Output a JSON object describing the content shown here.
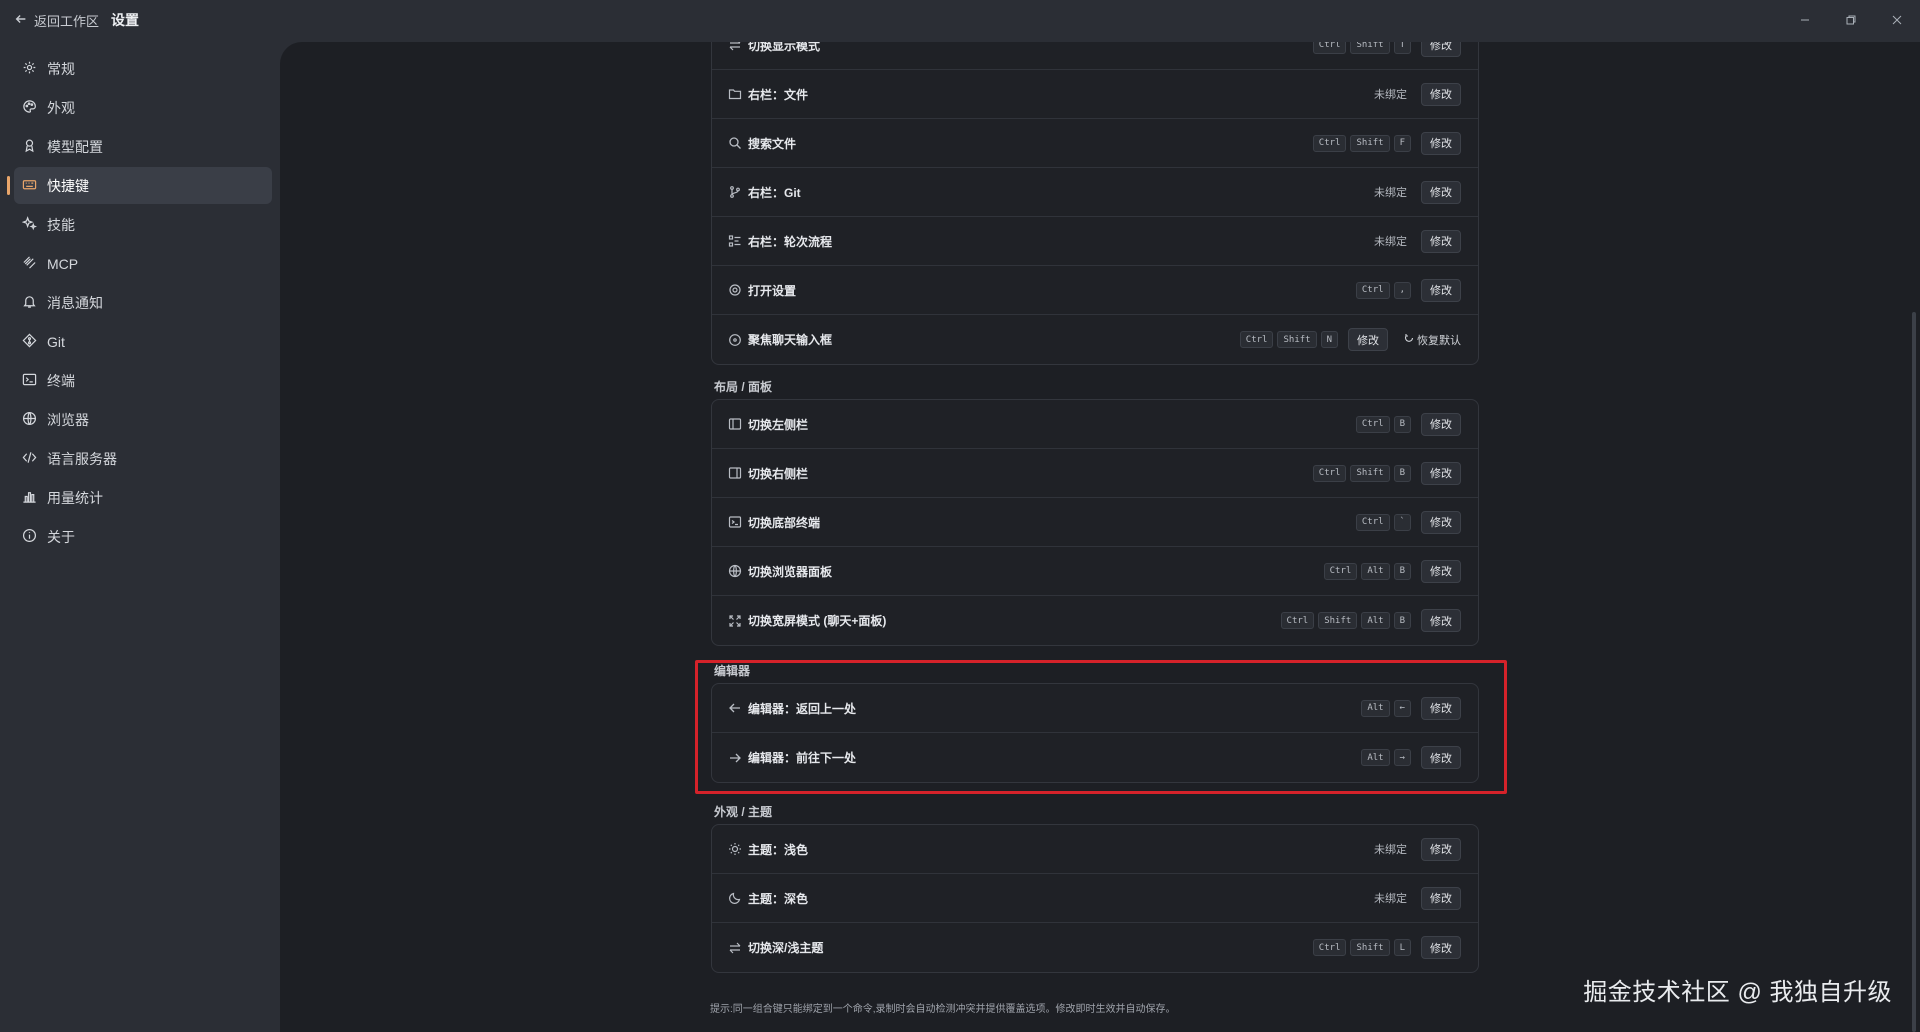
{
  "titlebar": {
    "back_label": "返回工作区",
    "title": "设置"
  },
  "sidebar": {
    "items": [
      {
        "label": "常规",
        "icon": "gear-icon"
      },
      {
        "label": "外观",
        "icon": "palette-icon"
      },
      {
        "label": "模型配置",
        "icon": "model-icon"
      },
      {
        "label": "快捷键",
        "icon": "keyboard-icon",
        "active": true
      },
      {
        "label": "技能",
        "icon": "sparkle-icon"
      },
      {
        "label": "MCP",
        "icon": "mcp-icon"
      },
      {
        "label": "消息通知",
        "icon": "bell-icon"
      },
      {
        "label": "Git",
        "icon": "git-icon"
      },
      {
        "label": "终端",
        "icon": "terminal-icon"
      },
      {
        "label": "浏览器",
        "icon": "globe-icon"
      },
      {
        "label": "语言服务器",
        "icon": "code-icon"
      },
      {
        "label": "用量统计",
        "icon": "bar-chart-icon"
      },
      {
        "label": "关于",
        "icon": "info-icon"
      }
    ]
  },
  "common": {
    "edit_label": "修改",
    "unbound_label": "未绑定",
    "reset_label": "恢复默认"
  },
  "sections": {
    "top": {
      "rows": [
        {
          "label": "切换显示模式",
          "keys": [
            "Ctrl",
            "Shift",
            "T"
          ]
        },
        {
          "label": "右栏：文件",
          "keys": []
        },
        {
          "label": "搜索文件",
          "keys": [
            "Ctrl",
            "Shift",
            "F"
          ]
        },
        {
          "label": "右栏：Git",
          "keys": []
        },
        {
          "label": "右栏：轮次流程",
          "keys": []
        },
        {
          "label": "打开设置",
          "keys": [
            "Ctrl",
            ","
          ]
        },
        {
          "label": "聚焦聊天输入框",
          "keys": [
            "Ctrl",
            "Shift",
            "N"
          ]
        }
      ]
    },
    "layout": {
      "title": "布局 / 面板",
      "rows": [
        {
          "label": "切换左侧栏",
          "keys": [
            "Ctrl",
            "B"
          ]
        },
        {
          "label": "切换右侧栏",
          "keys": [
            "Ctrl",
            "Shift",
            "B"
          ]
        },
        {
          "label": "切换底部终端",
          "keys": [
            "Ctrl",
            "`"
          ]
        },
        {
          "label": "切换浏览器面板",
          "keys": [
            "Ctrl",
            "Alt",
            "B"
          ]
        },
        {
          "label": "切换宽屏模式 (聊天+面板)",
          "keys": [
            "Ctrl",
            "Shift",
            "Alt",
            "B"
          ]
        }
      ]
    },
    "editor": {
      "title": "编辑器",
      "rows": [
        {
          "label": "编辑器：返回上一处",
          "keys": [
            "Alt",
            "←"
          ]
        },
        {
          "label": "编辑器：前往下一处",
          "keys": [
            "Alt",
            "→"
          ]
        }
      ]
    },
    "theme": {
      "title": "外观 / 主题",
      "rows": [
        {
          "label": "主题：浅色",
          "keys": []
        },
        {
          "label": "主题：深色",
          "keys": []
        },
        {
          "label": "切换深/浅主题",
          "keys": [
            "Ctrl",
            "Shift",
            "L"
          ]
        }
      ]
    }
  },
  "tip": "提示:同一组合键只能绑定到一个命令,录制时会自动检测冲突并提供覆盖选项。修改即时生效并自动保存。",
  "watermark": "掘金技术社区 @ 我独自升级",
  "colors": {
    "accent": "#e8a56a",
    "highlight": "#d5222a",
    "panel_bg": "#1d1f24",
    "chrome_bg": "#2b2e35"
  }
}
